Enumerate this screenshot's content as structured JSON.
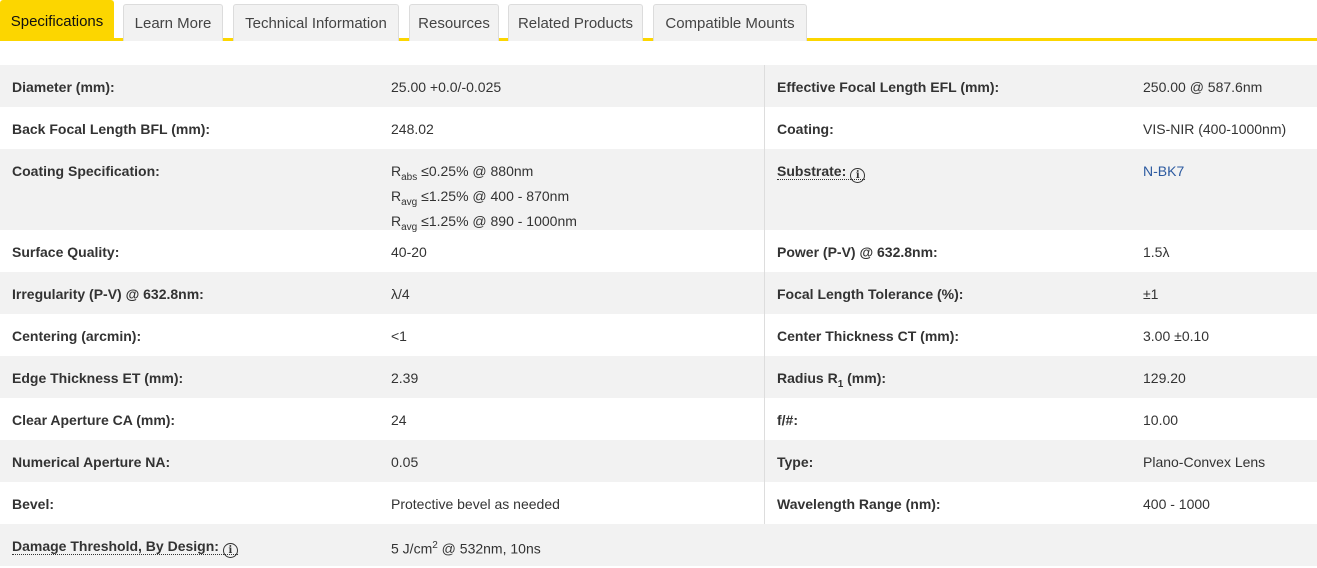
{
  "tabs": [
    {
      "label": "Specifications",
      "active": true
    },
    {
      "label": "Learn More"
    },
    {
      "label": "Technical Information"
    },
    {
      "label": "Resources"
    },
    {
      "label": "Related Products"
    },
    {
      "label": "Compatible Mounts"
    }
  ],
  "specs": {
    "diameter": {
      "label": "Diameter (mm):",
      "value": "25.00 +0.0/-0.025"
    },
    "efl": {
      "label": "Effective Focal Length EFL (mm):",
      "value": "250.00 @ 587.6nm"
    },
    "bfl": {
      "label": "Back Focal Length BFL (mm):",
      "value": "248.02"
    },
    "coating": {
      "label": "Coating:",
      "value": "VIS-NIR (400-1000nm)"
    },
    "coating_spec": {
      "label": "Coating Specification:",
      "lines": [
        {
          "base": "R",
          "sub": "abs",
          "rest": " ≤0.25% @ 880nm"
        },
        {
          "base": "R",
          "sub": "avg",
          "rest": " ≤1.25% @ 400 - 870nm"
        },
        {
          "base": "R",
          "sub": "avg",
          "rest": " ≤1.25% @ 890 - 1000nm"
        }
      ]
    },
    "substrate": {
      "label": "Substrate:",
      "info_icon": "info-icon",
      "value": "N-BK7"
    },
    "surface_quality": {
      "label": "Surface Quality:",
      "value": "40-20"
    },
    "power": {
      "label": "Power (P-V) @ 632.8nm:",
      "value": "1.5λ"
    },
    "irregularity": {
      "label": "Irregularity (P-V) @ 632.8nm:",
      "value": "λ/4"
    },
    "focal_tolerance": {
      "label": "Focal Length Tolerance (%):",
      "value": "±1"
    },
    "centering": {
      "label": "Centering (arcmin):",
      "value": "<1"
    },
    "center_thickness": {
      "label": "Center Thickness CT (mm):",
      "value": "3.00 ±0.10"
    },
    "edge_thickness": {
      "label": "Edge Thickness ET (mm):",
      "value": "2.39"
    },
    "radius": {
      "label_pre": "Radius R",
      "label_sub": "1",
      "label_post": " (mm):",
      "value": "129.20"
    },
    "clear_aperture": {
      "label": "Clear Aperture CA (mm):",
      "value": "24"
    },
    "fnumber": {
      "label": "f/#:",
      "value": "10.00"
    },
    "na": {
      "label": "Numerical Aperture NA:",
      "value": "0.05"
    },
    "type": {
      "label": "Type:",
      "value": "Plano-Convex Lens"
    },
    "bevel": {
      "label": "Bevel:",
      "value": "Protective bevel as needed"
    },
    "wavelength": {
      "label": "Wavelength Range (nm):",
      "value": "400 - 1000"
    },
    "damage": {
      "label": "Damage Threshold, By Design:",
      "info_icon": "info-icon",
      "value_pre": "5 J/cm",
      "value_sup": "2",
      "value_post": " @ 532nm, 10ns"
    }
  },
  "icons": {
    "info_glyph": "i"
  },
  "colors": {
    "accent": "#fcd600",
    "link": "#2c5aa0",
    "row_alt": "#f2f2f2"
  }
}
